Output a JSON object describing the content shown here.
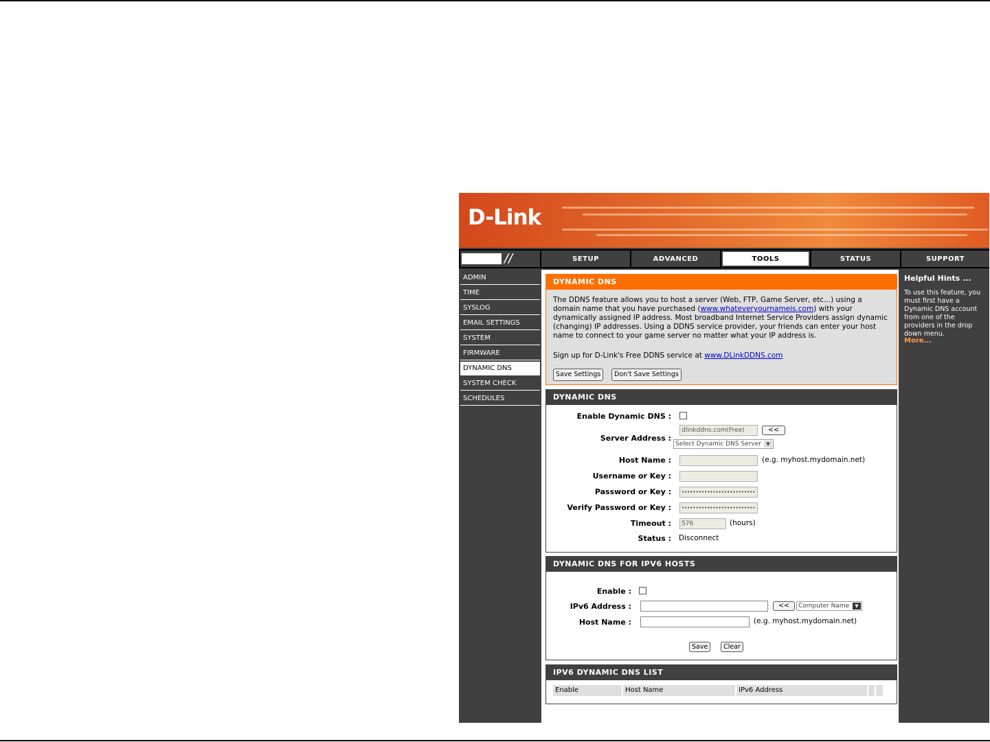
{
  "brand": {
    "logo_text": "D-Link"
  },
  "nav": {
    "tabs": [
      {
        "label": "SETUP"
      },
      {
        "label": "ADVANCED"
      },
      {
        "label": "TOOLS"
      },
      {
        "label": "STATUS"
      },
      {
        "label": "SUPPORT"
      }
    ],
    "active": "TOOLS"
  },
  "sidebar": {
    "items": [
      {
        "label": "ADMIN"
      },
      {
        "label": "TIME"
      },
      {
        "label": "SYSLOG"
      },
      {
        "label": "EMAIL SETTINGS"
      },
      {
        "label": "SYSTEM"
      },
      {
        "label": "FIRMWARE"
      },
      {
        "label": "DYNAMIC DNS"
      },
      {
        "label": "SYSTEM CHECK"
      },
      {
        "label": "SCHEDULES"
      }
    ],
    "active": "DYNAMIC DNS"
  },
  "intro": {
    "title": "DYNAMIC DNS",
    "text_1": "The DDNS feature allows you to host a server (Web, FTP, Game Server, etc...) using a domain name that you have purchased (",
    "link_1": "www.whateveryournameis.com",
    "text_2": ") with your dynamically assigned IP address. Most broadband Internet Service Providers assign dynamic (changing) IP addresses. Using a DDNS service provider, your friends can enter your host name to connect to your game server no matter what your IP address is.",
    "signup_text": "Sign up for D-Link's Free DDNS service at ",
    "signup_link": "www.DLinkDDNS.com",
    "save_label": "Save Settings",
    "dont_save_label": "Don't Save Settings"
  },
  "ddns": {
    "title": "DYNAMIC DNS",
    "enable_label": "Enable Dynamic DNS :",
    "server_label": "Server Address :",
    "server_value": "dlinkddns.com(Free)",
    "copy_button": "<<",
    "server_select": "Select Dynamic DNS Server",
    "host_label": "Host Name :",
    "host_hint": "(e.g. myhost.mydomain.net)",
    "username_label": "Username or Key :",
    "password_label": "Password or Key :",
    "password_value": "••••••••••••••••••••••••••",
    "verify_label": "Verify Password or Key :",
    "verify_value": "••••••••••••••••••••••••••",
    "timeout_label": "Timeout  :",
    "timeout_value": "576",
    "timeout_unit": "(hours)",
    "status_label": "Status  :",
    "status_value": "Disconnect"
  },
  "ipv6": {
    "title": "DYNAMIC DNS FOR IPV6 HOSTS",
    "enable_label": "Enable :",
    "address_label": "IPv6 Address :",
    "copy_button": "<<",
    "computer_select": "Computer Name",
    "host_label": "Host Name :",
    "host_hint": "(e.g. myhost.mydomain.net)",
    "save_label": "Save",
    "clear_label": "Clear"
  },
  "list": {
    "title": "IPV6 DYNAMIC DNS LIST",
    "columns": [
      "Enable",
      "Host Name",
      "IPv6 Address"
    ]
  },
  "hints": {
    "title": "Helpful Hints ...",
    "text": "To use this feature, you must first have a Dynamic DNS account from one of the providers in the drop down menu.",
    "more": "More..."
  }
}
